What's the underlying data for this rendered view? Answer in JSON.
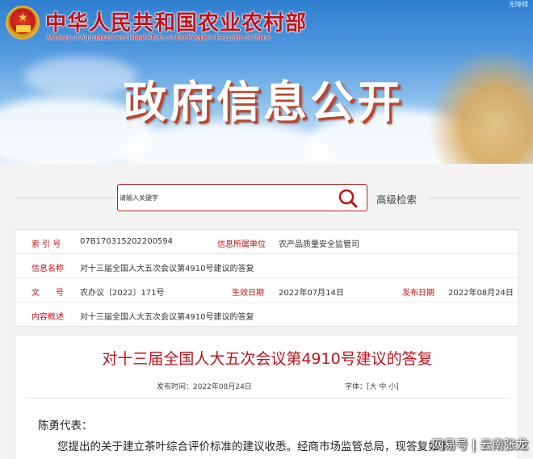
{
  "header": {
    "ministry_cn": "中华人民共和国农业农村部",
    "ministry_en": "Ministry of Agriculture and Rural Affairs of the People's Republic of China",
    "banner_title": "政府信息公开",
    "corner_mark": "无障碍"
  },
  "search": {
    "placeholder": "请输入关键字",
    "advanced_label": "高级检索"
  },
  "info": {
    "index_label": "索 引 号",
    "index_value": "07B170315202200594",
    "org_label": "信息所属单位",
    "org_value": "农产品质量安全监管司",
    "name_label": "信息名称",
    "name_value": "对十三届全国人大五次会议第4910号建议的答复",
    "doc_label": "文　　号",
    "doc_value": "农办议〔2022〕171号",
    "effective_label": "生效日期",
    "effective_value": "2022年07月14日",
    "publish_label": "发布日期",
    "publish_value": "2022年08月24日",
    "summary_label": "内容概述",
    "summary_value": "对十三届全国人大五次会议第4910号建议的答复"
  },
  "article": {
    "title": "对十三届全国人大五次会议第4910号建议的答复",
    "publish_time": "发布时间：2022年08月24日",
    "font_size_label": "字体：[大 中 小]",
    "salutation": "陈勇代表：",
    "first_line": "您提出的关于建立茶叶综合评价标准的建议收悉。经商市场监管总局，现答复如下："
  },
  "watermark": "网易号 | 云南张龙",
  "colors": {
    "accent_red": "#c1121a",
    "search_border": "#b02325",
    "page_bg": "#f3f3f3"
  }
}
